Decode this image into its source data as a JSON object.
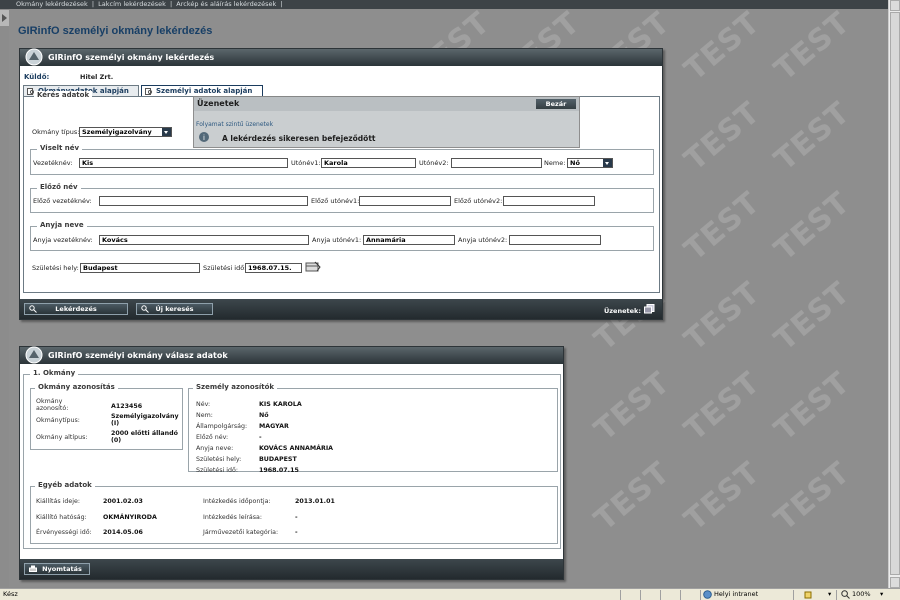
{
  "topbar": {
    "items": [
      "Okmány lekérdezések",
      "|",
      "Lakcím lekérdezések",
      "|",
      "Arckép és aláírás lekérdezések",
      "|"
    ]
  },
  "watermark": "TEST",
  "page_title": "GIRinfO személyi okmány lekérdezés",
  "query_panel": {
    "title": "GIRinfO személyi okmány lekérdezés",
    "sender_label": "Küldő:",
    "sender_value": "Hitel Zrt.",
    "tabs": [
      "Okmányadatok alapján",
      "Személyi adatok alapján"
    ],
    "fieldset_title": "Kérés adatok",
    "doc_type_label": "Okmány típus:",
    "doc_type_value": "Személyigazolvány",
    "current_name": {
      "title": "Viselt név",
      "surname_label": "Vezetéknév:",
      "surname_value": "Kis",
      "first1_label": "Utónév1:",
      "first1_value": "Karola",
      "first2_label": "Utónév2:",
      "first2_value": "",
      "sex_label": "Neme:",
      "sex_value": "Nő"
    },
    "previous_name": {
      "title": "Előző név",
      "surname_label": "Előző vezetéknév:",
      "surname_value": "",
      "first1_label": "Előző utónév1:",
      "first1_value": "",
      "first2_label": "Előző utónév2:",
      "first2_value": ""
    },
    "mother_name": {
      "title": "Anyja neve",
      "surname_label": "Anyja vezetéknév:",
      "surname_value": "Kovács",
      "first1_label": "Anyja utónév1:",
      "first1_value": "Annamária",
      "first2_label": "Anyja utónév2:",
      "first2_value": ""
    },
    "birth_place_label": "Születési hely:",
    "birth_place_value": "Budapest",
    "birth_date_label": "Születési idő:",
    "birth_date_value": "1968.07.15.",
    "buttons": {
      "query": "Lekérdezés",
      "new_search": "Új keresés"
    },
    "messages_label": "Üzenetek:"
  },
  "message_popup": {
    "title": "Üzenetek",
    "close_label": "Bezár",
    "process_label": "Folyamat szintű üzenetek",
    "message": "A lekérdezés sikeresen befejeződött"
  },
  "result_panel": {
    "title": "GIRinfO személyi okmány válasz adatok",
    "section_title": "1. Okmány",
    "doc_id": {
      "title": "Okmány azonosítás",
      "rows": [
        {
          "label": "Okmány azonosító:",
          "value": "A123456"
        },
        {
          "label": "Okmánytípus:",
          "value": "Személyigazolvány (I)"
        },
        {
          "label": "Okmány altípus:",
          "value": "2000 előtti állandó (0)"
        }
      ]
    },
    "person_id": {
      "title": "Személy azonosítók",
      "rows": [
        {
          "label": "Név:",
          "value": "KIS KAROLA"
        },
        {
          "label": "Nem:",
          "value": "Nő"
        },
        {
          "label": "Állampolgárság:",
          "value": "MAGYAR"
        },
        {
          "label": "Előző név:",
          "value": "-"
        },
        {
          "label": "Anyja neve:",
          "value": "KOVÁCS ANNAMÁRIA"
        },
        {
          "label": "Születési hely:",
          "value": "BUDAPEST"
        },
        {
          "label": "Születési idő:",
          "value": "1968.07.15"
        }
      ]
    },
    "other": {
      "title": "Egyéb adatok",
      "left": [
        {
          "label": "Kiállítás ideje:",
          "value": "2001.02.03"
        },
        {
          "label": "Kiállító hatóság:",
          "value": "OKMÁNYIRODA"
        },
        {
          "label": "Érvényességi idő:",
          "value": "2014.05.06"
        }
      ],
      "right": [
        {
          "label": "Intézkedés időpontja:",
          "value": "2013.01.01"
        },
        {
          "label": "Intézkedés leírása:",
          "value": "-"
        },
        {
          "label": "Járművezetői kategória:",
          "value": "-"
        }
      ]
    },
    "print_label": "Nyomtatás"
  },
  "statusbar": {
    "status": "Kész",
    "zone": "Helyi intranet",
    "zoom": "100%"
  }
}
